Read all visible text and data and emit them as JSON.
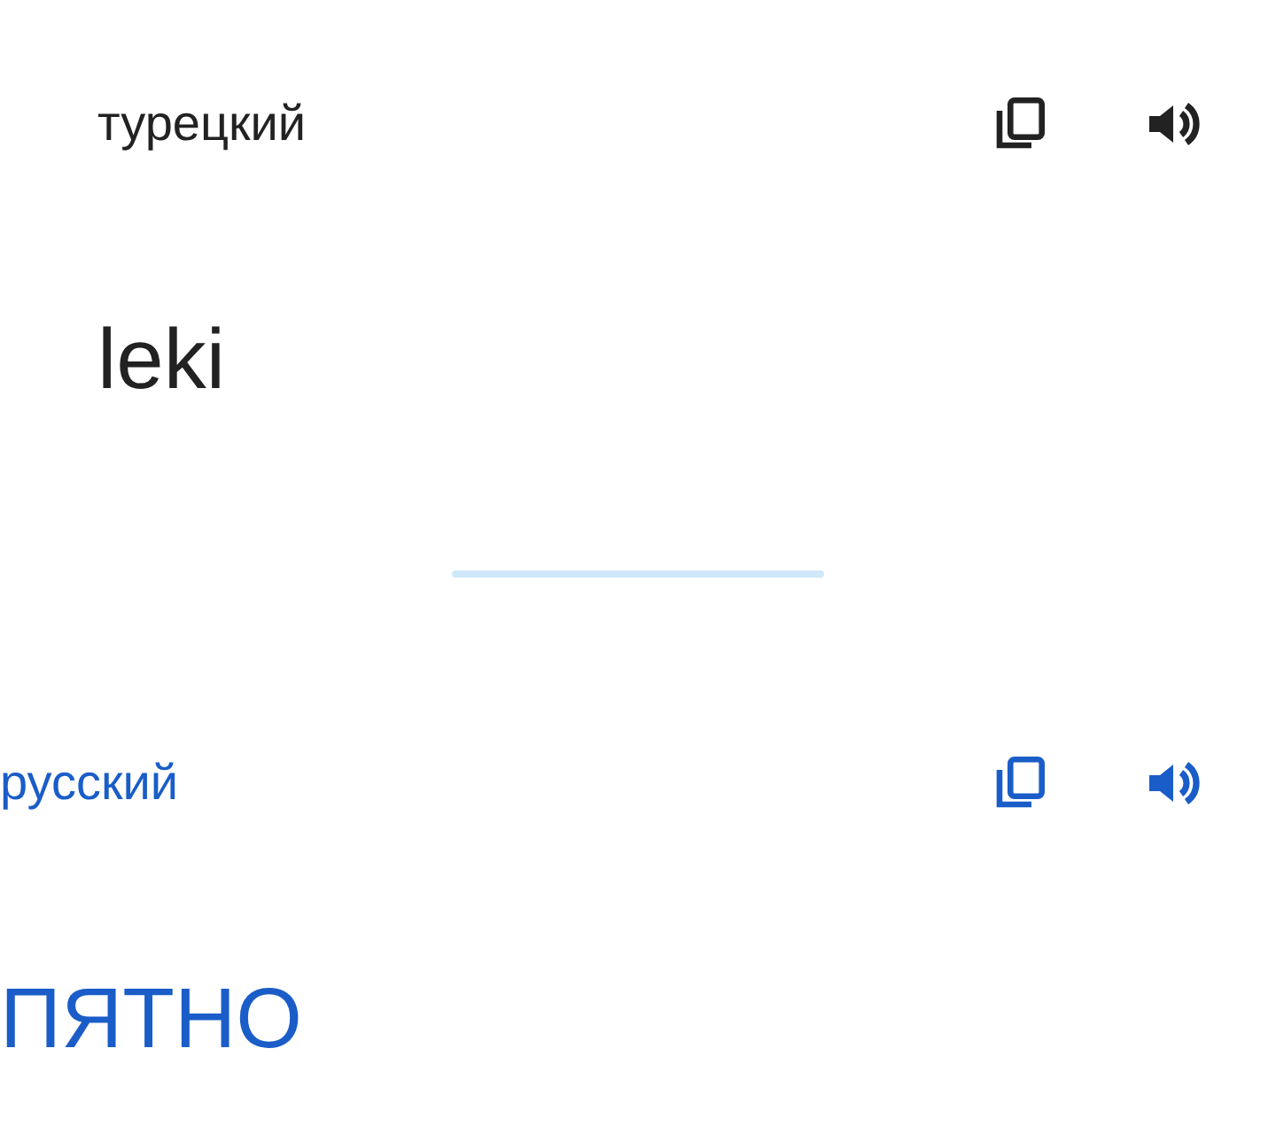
{
  "panels": [
    {
      "kind": "source",
      "language": "турецкий",
      "text": "leki"
    },
    {
      "kind": "target",
      "language": "русский",
      "text": "ПЯТНО"
    }
  ]
}
